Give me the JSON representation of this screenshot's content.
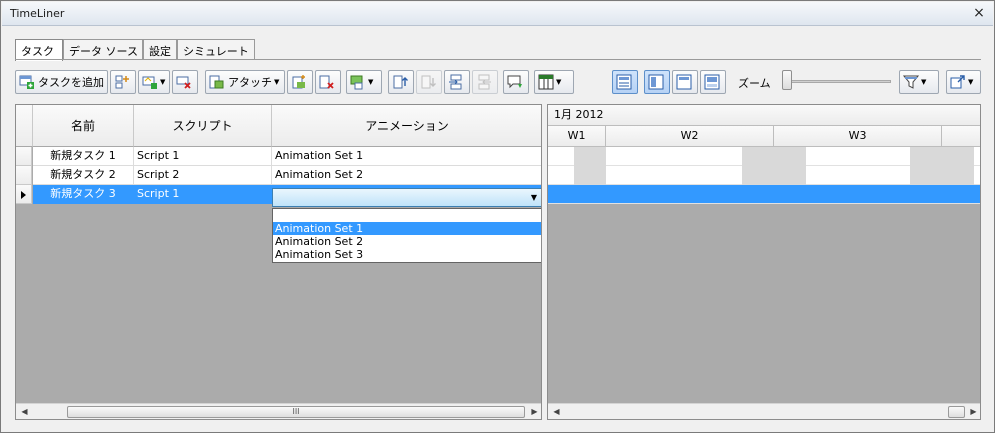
{
  "window": {
    "title": "TimeLiner",
    "close_glyph": "×"
  },
  "tabs": [
    {
      "label": "タスク",
      "active": true
    },
    {
      "label": "データ ソース",
      "active": false
    },
    {
      "label": "設定",
      "active": false
    },
    {
      "label": "シミュレート",
      "active": false
    }
  ],
  "toolbar": {
    "add_task_label": "タスクを追加",
    "attach_label": "アタッチ",
    "zoom_label": "ズーム",
    "icons": [
      "add-task-icon",
      "insert-task-icon",
      "auto-add-icon",
      "delete-task-icon",
      "attach-icon",
      "auto-attach-icon",
      "clear-attach-icon",
      "find-items-icon",
      "move-up-icon",
      "move-down-icon",
      "indent-icon",
      "outdent-icon",
      "comment-icon",
      "columns-icon",
      "view-both-icon",
      "view-grid-icon",
      "view-gantt-icon",
      "view-chart-icon",
      "filter-icon",
      "export-icon"
    ],
    "zoom_level": 0.0
  },
  "grid": {
    "columns": {
      "name": "名前",
      "script": "スクリプト",
      "animation": "アニメーション"
    },
    "rows": [
      {
        "name": "新規タスク 1",
        "script": "Script 1",
        "animation": "Animation Set 1"
      },
      {
        "name": "新規タスク 2",
        "script": "Script 2",
        "animation": "Animation Set 2"
      },
      {
        "name": "新規タスク 3",
        "script": "Script 1",
        "animation": ""
      }
    ],
    "selected_row": 2,
    "hscroll_thumb_glyph": "III"
  },
  "dropdown": {
    "options": [
      "Animation Set 1",
      "Animation Set 2",
      "Animation Set 3"
    ],
    "highlighted": 0
  },
  "gantt": {
    "month_label": "1月 2012",
    "weeks": [
      "W1",
      "W2",
      "W3"
    ]
  },
  "colors": {
    "selection": "#3399ff",
    "pane_bg": "#ababab",
    "weekend_shade": "#d9d9d9"
  }
}
